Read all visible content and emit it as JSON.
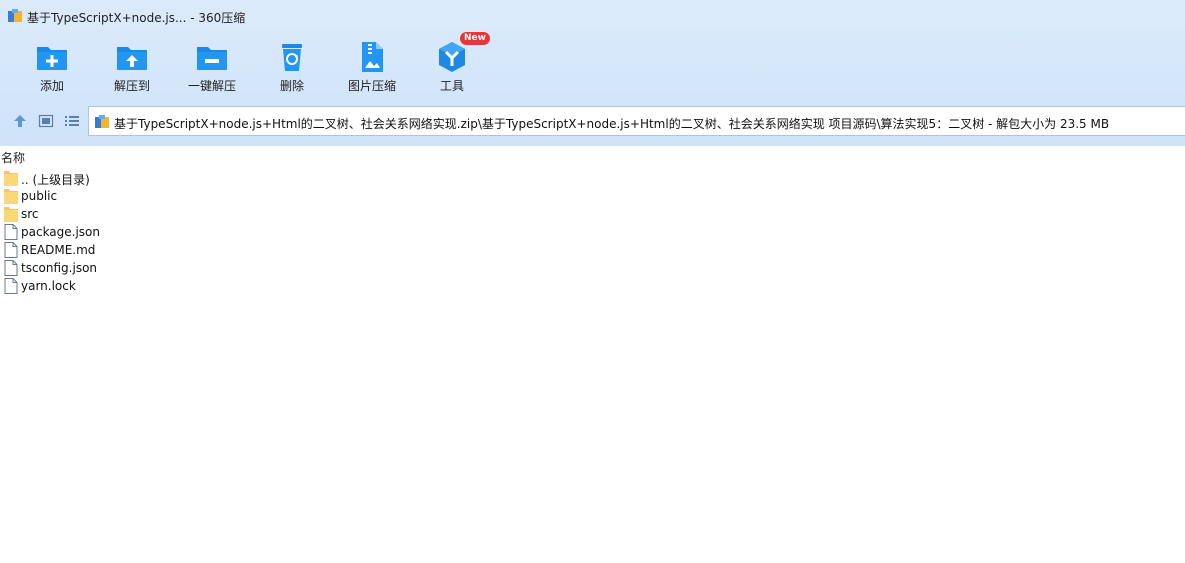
{
  "window": {
    "title": "基于TypeScriptX+node.js... - 360压缩"
  },
  "toolbar": {
    "add": "添加",
    "extract_to": "解压到",
    "one_click_extract": "一键解压",
    "delete": "删除",
    "image_compress": "图片压缩",
    "tools": "工具",
    "tools_badge": "New"
  },
  "navigation": {
    "path": "基于TypeScriptX+node.js+Html的二叉树、社会关系网络实现.zip\\基于TypeScriptX+node.js+Html的二叉树、社会关系网络实现 项目源码\\算法实现5：二叉树 - 解包大小为 23.5 MB"
  },
  "list": {
    "column_name": "名称",
    "items": [
      {
        "name": ".. (上级目录)",
        "type": "folder"
      },
      {
        "name": "public",
        "type": "folder"
      },
      {
        "name": "src",
        "type": "folder"
      },
      {
        "name": "package.json",
        "type": "file"
      },
      {
        "name": "README.md",
        "type": "file"
      },
      {
        "name": "tsconfig.json",
        "type": "file"
      },
      {
        "name": "yarn.lock",
        "type": "file"
      }
    ]
  },
  "colors": {
    "accent": "#1e88e5",
    "header_bg": "#d6e8fb",
    "badge": "#e8353a",
    "folder": "#f5c65a"
  }
}
